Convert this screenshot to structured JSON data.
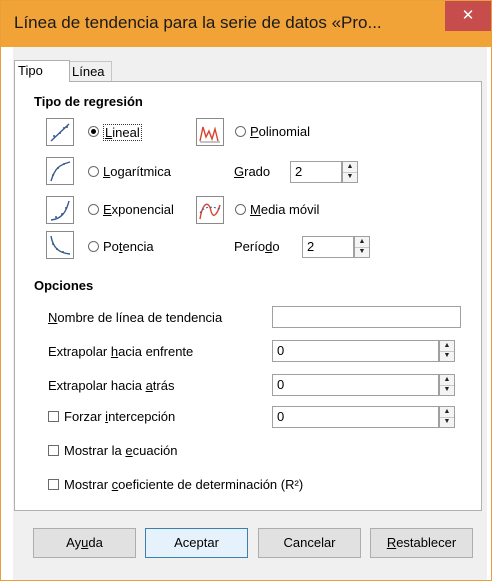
{
  "window": {
    "title": "Línea de tendencia para la serie de datos «Pro...",
    "close_glyph": "✕"
  },
  "tabs": [
    {
      "label": "Tipo"
    },
    {
      "label": "Línea"
    }
  ],
  "regression": {
    "heading": "Tipo de regresión",
    "options": [
      {
        "pre": "",
        "u": "L",
        "post": "ineal",
        "selected": true
      },
      {
        "pre": "",
        "u": "L",
        "post": "ogarítmica",
        "selected": false
      },
      {
        "pre": "",
        "u": "E",
        "post": "xponencial",
        "selected": false
      },
      {
        "pre": "Po",
        "u": "t",
        "post": "encia",
        "selected": false
      },
      {
        "pre": "",
        "u": "P",
        "post": "olinomial",
        "selected": false
      },
      {
        "pre": "",
        "u": "M",
        "post": "edia móvil",
        "selected": false
      }
    ],
    "degree": {
      "pre": "",
      "u": "G",
      "post": "rado",
      "value": "2"
    },
    "period": {
      "pre": "Perío",
      "u": "d",
      "post": "o",
      "value": "2"
    }
  },
  "options": {
    "heading": "Opciones",
    "trend_name": {
      "pre": "",
      "u": "N",
      "post": "ombre de línea de tendencia",
      "value": ""
    },
    "extrap_fwd": {
      "pre": "Extrapolar ",
      "u": "h",
      "post": "acia enfrente",
      "value": "0"
    },
    "extrap_back": {
      "pre": "Extrapolar hacia ",
      "u": "a",
      "post": "trás",
      "value": "0"
    },
    "force_intercept": {
      "pre": "Forzar ",
      "u": "i",
      "post": "ntercepción",
      "value": "0",
      "checked": false
    },
    "show_equation": {
      "pre": "Mostrar la ",
      "u": "e",
      "post": "cuación",
      "checked": false
    },
    "show_r2": {
      "pre": "Mostrar ",
      "u": "c",
      "post": "oeficiente de determinación (R²)",
      "checked": false
    }
  },
  "buttons": {
    "help": {
      "pre": "Ay",
      "u": "u",
      "post": "da"
    },
    "ok": {
      "label": "Aceptar"
    },
    "cancel": {
      "label": "Cancelar"
    },
    "reset": {
      "pre": "",
      "u": "R",
      "post": "establecer"
    }
  },
  "colors": {
    "titlebar": "#f1a338",
    "close": "#c74d4d",
    "icon_curve": "#2c5d9e",
    "poly_curve": "#d9432f"
  }
}
